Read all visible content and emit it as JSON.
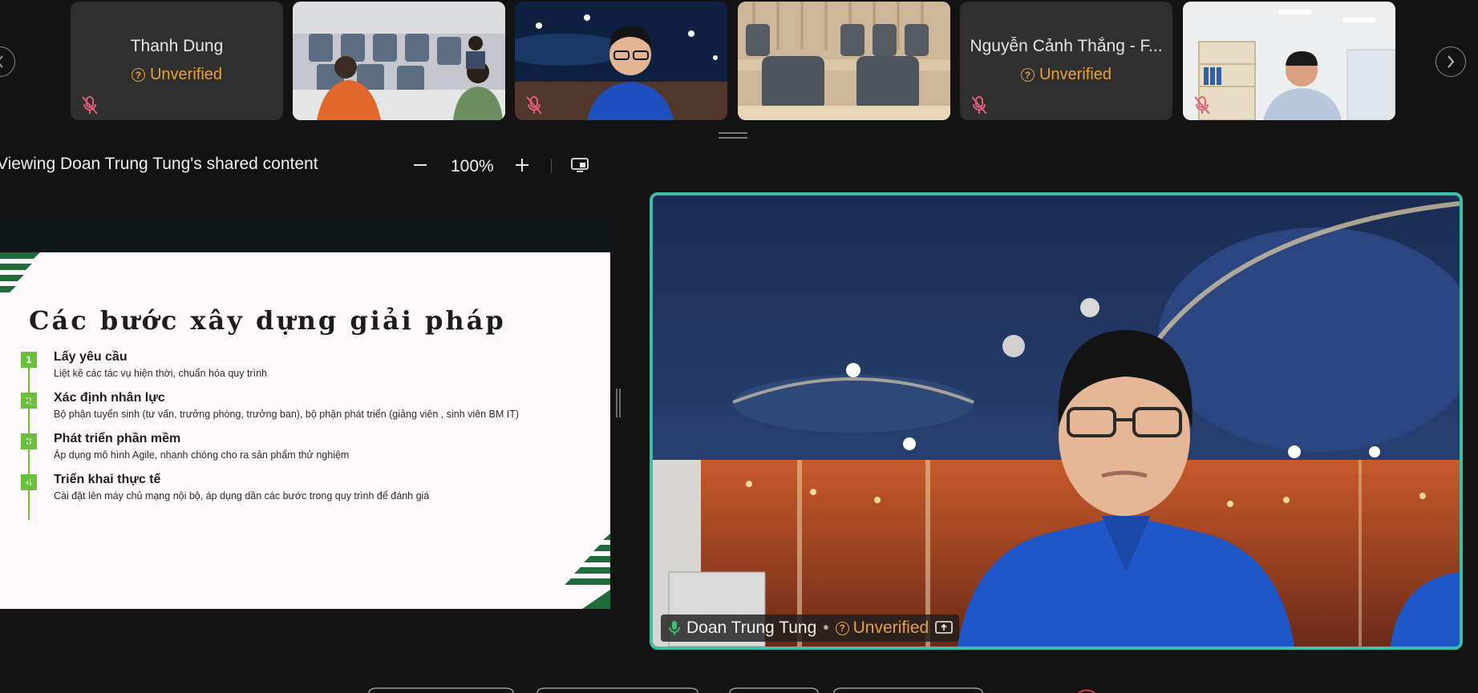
{
  "app": {
    "accent_border": "#3bbfa6",
    "warning_color": "#e8a23a"
  },
  "participants": [
    {
      "name": "Thanh Dung",
      "status": "Unverified",
      "muted": true,
      "video": false
    },
    {
      "name": "",
      "status": "",
      "muted": false,
      "video": true
    },
    {
      "name": "",
      "status": "",
      "muted": true,
      "video": true
    },
    {
      "name": "",
      "status": "",
      "muted": false,
      "video": true
    },
    {
      "name": "Nguyễn Cảnh Thắng - F...",
      "status": "Unverified",
      "muted": true,
      "video": false
    },
    {
      "name": "",
      "status": "",
      "muted": true,
      "video": true
    }
  ],
  "share_toolbar": {
    "title": "Viewing Doan Trung Tung's shared content",
    "zoom": "100%",
    "zoom_out_icon": "minus-icon",
    "zoom_in_icon": "plus-icon",
    "view_options_icon": "screen-view-icon"
  },
  "slide": {
    "title": "Các bước xây dựng giải pháp",
    "steps": [
      {
        "num": "1",
        "heading": "Lấy yêu cầu",
        "detail": "Liệt kê các tác vụ hiện thời, chuẩn hóa quy trình"
      },
      {
        "num": "2",
        "heading": "Xác định nhân lực",
        "detail": "Bộ phận tuyển sinh (tư vấn, trưởng phòng, trưởng ban), bộ phận phát triển (giảng viên , sinh viên BM IT)"
      },
      {
        "num": "3",
        "heading": "Phát triển phần mềm",
        "detail": "Áp dụng mô hình Agile, nhanh chóng cho ra sản phẩm thử nghiệm"
      },
      {
        "num": "4",
        "heading": "Triển khai thực tế",
        "detail": "Cài đặt lên máy chủ mạng nội bộ, áp dụng dần các bước trong quy trình để đánh giá"
      }
    ]
  },
  "speaker": {
    "name": "Doan Trung Tung",
    "separator": "•",
    "status": "Unverified",
    "mic_icon": "microphone-icon",
    "share_icon": "screen-share-icon"
  }
}
